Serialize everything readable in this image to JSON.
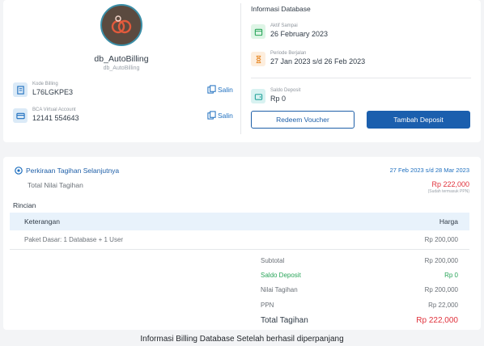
{
  "profile": {
    "db_name": "db_AutoBilling",
    "db_subname": "db_AutoBilling"
  },
  "kode_billing": {
    "label": "Kode Billing",
    "value": "L76LGKPE3",
    "copy_label": "Salin"
  },
  "virtual_account": {
    "label": "BCA Virtual Account",
    "value": "12141 554643",
    "copy_label": "Salin"
  },
  "db_info": {
    "title": "Informasi Database",
    "active_until_label": "Aktif Sampai",
    "active_until_value": "26 February 2023",
    "period_label": "Periode Berjalan",
    "period_value": "27 Jan 2023 s/d 26 Feb 2023",
    "deposit_label": "Saldo Deposit",
    "deposit_value": "Rp 0",
    "redeem_label": "Redeem Voucher",
    "tambah_label": "Tambah Deposit"
  },
  "billing": {
    "title": "Perkiraan Tagihan Selanjutnya",
    "date_range": "27 Feb 2023 s/d 28 Mar 2023",
    "total_label": "Total Nilai Tagihan",
    "total_value": "Rp 222,000",
    "total_note": "(Sudah termasuk PPN)",
    "rincian_label": "Rincian",
    "table_headers": {
      "keterangan": "Keterangan",
      "harga": "Harga"
    },
    "items": [
      {
        "desc": "Paket Dasar: 1 Database + 1 User",
        "price": "Rp 200,000"
      }
    ],
    "summary": [
      {
        "label": "Subtotal",
        "value": "Rp 200,000",
        "color": "#6b7178"
      },
      {
        "label": "Saldo Deposit",
        "value": "Rp 0",
        "color": "#2aa55a"
      },
      {
        "label": "Nilai Tagihan",
        "value": "Rp 200,000",
        "color": "#6b7178"
      },
      {
        "label": "PPN",
        "value": "Rp 22,000",
        "color": "#6b7178"
      }
    ],
    "grand_total_label": "Total Tagihan",
    "grand_total_value": "Rp 222,000"
  },
  "caption": "Informasi Billing Database Setelah berhasil diperpanjang",
  "colors": {
    "primary": "#1b5fae",
    "danger": "#e0323c",
    "success": "#2aa55a"
  },
  "icons": {
    "kode_billing": "receipt-icon",
    "virtual_account": "card-icon",
    "copy": "copy-icon",
    "active": "calendar-icon",
    "period": "hourglass-icon",
    "deposit": "wallet-icon",
    "billing": "clock-icon"
  }
}
